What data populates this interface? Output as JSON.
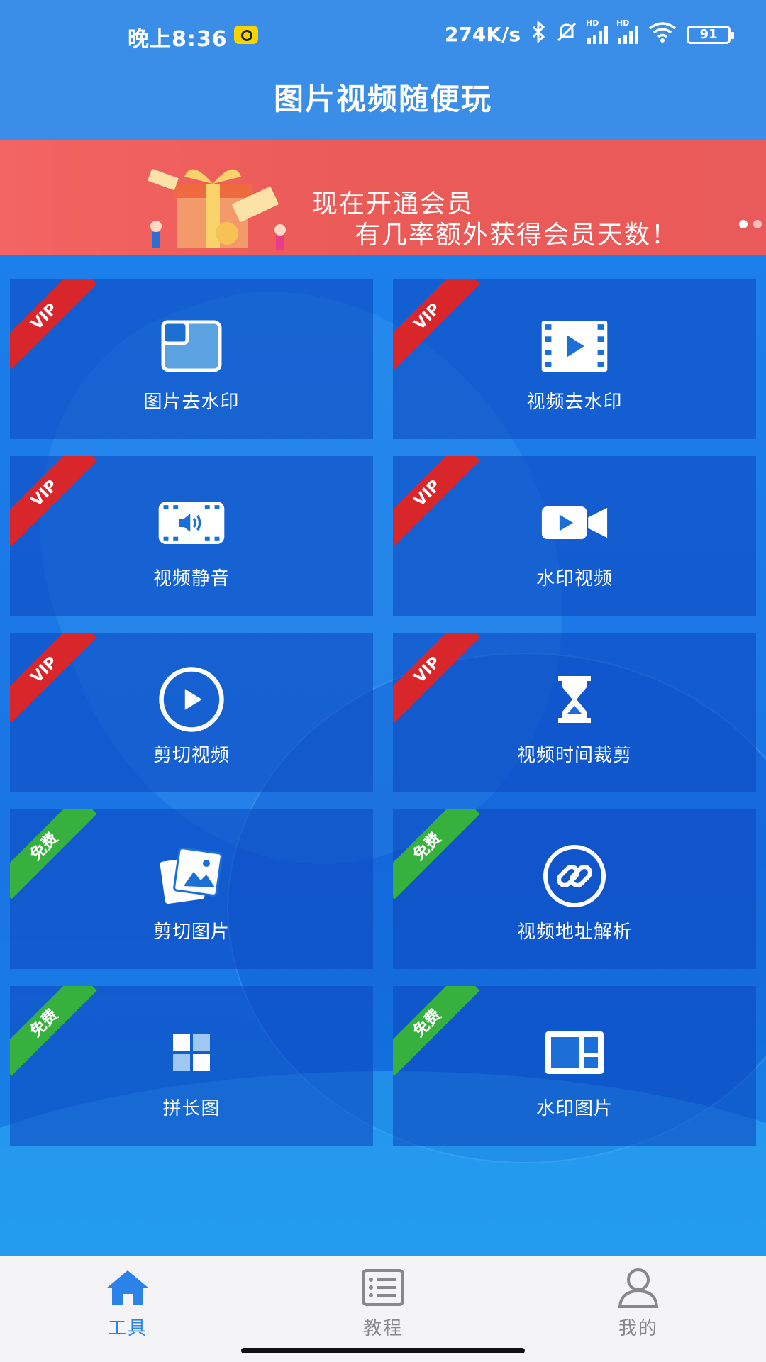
{
  "status_bar": {
    "time": "晚上8:36",
    "network_speed": "274K/s",
    "battery": "91",
    "signal_label": "HD"
  },
  "header": {
    "title": "图片视频随便玩"
  },
  "banner": {
    "line1": "现在开通会员",
    "line2": "有几率额外获得会员天数！",
    "pages": 2,
    "current_page": 1
  },
  "tools": [
    {
      "label": "图片去水印",
      "badge": "VIP",
      "icon": "image-frame-icon"
    },
    {
      "label": "视频去水印",
      "badge": "VIP",
      "icon": "film-play-icon"
    },
    {
      "label": "视频静音",
      "badge": "VIP",
      "icon": "mute-volume-icon"
    },
    {
      "label": "水印视频",
      "badge": "VIP",
      "icon": "video-camera-icon"
    },
    {
      "label": "剪切视频",
      "badge": "VIP",
      "icon": "play-circle-icon"
    },
    {
      "label": "视频时间裁剪",
      "badge": "VIP",
      "icon": "hourglass-icon"
    },
    {
      "label": "剪切图片",
      "badge": "免费",
      "icon": "photo-stack-icon"
    },
    {
      "label": "视频地址解析",
      "badge": "免费",
      "icon": "link-icon"
    },
    {
      "label": "拼长图",
      "badge": "免费",
      "icon": "grid-tiles-icon"
    },
    {
      "label": "水印图片",
      "badge": "免费",
      "icon": "layout-panel-icon"
    }
  ],
  "bottom_nav": [
    {
      "label": "工具",
      "icon": "home-icon",
      "active": true
    },
    {
      "label": "教程",
      "icon": "list-doc-icon",
      "active": false
    },
    {
      "label": "我的",
      "icon": "user-icon",
      "active": false
    }
  ],
  "colors": {
    "primary": "#3a8ee8",
    "vip_ribbon": "#d9262b",
    "free_ribbon": "#36b13d",
    "banner": "#ea5a56",
    "nav_active": "#2b83e9"
  }
}
